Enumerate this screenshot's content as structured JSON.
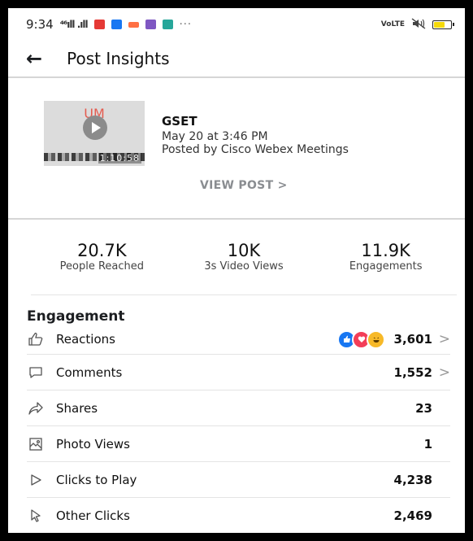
{
  "status_bar": {
    "time": "9:34",
    "signal_text": "⁴⁶ıll .ıll",
    "more": "···",
    "volte": "VoLTE"
  },
  "header": {
    "title": "Post Insights"
  },
  "post": {
    "thumbnail_text": "UM",
    "thumbnail_time": "1:10:58",
    "title": "GSET",
    "date": "May 20 at 3:46 PM",
    "posted_by": "Posted by Cisco Webex Meetings",
    "view_post_label": "VIEW POST >"
  },
  "metrics": [
    {
      "value": "20.7K",
      "label": "People Reached"
    },
    {
      "value": "10K",
      "label": "3s Video Views"
    },
    {
      "value": "11.9K",
      "label": "Engagements"
    }
  ],
  "engagement": {
    "title": "Engagement",
    "rows": [
      {
        "label": "Reactions",
        "value": "3,601",
        "icon": "thumbs-up-icon",
        "chevron": ">"
      },
      {
        "label": "Comments",
        "value": "1,552",
        "icon": "comment-icon",
        "chevron": ">"
      },
      {
        "label": "Shares",
        "value": "23",
        "icon": "share-icon",
        "chevron": ""
      },
      {
        "label": "Photo Views",
        "value": "1",
        "icon": "photo-icon",
        "chevron": ""
      },
      {
        "label": "Clicks to Play",
        "value": "4,238",
        "icon": "play-icon",
        "chevron": ""
      },
      {
        "label": "Other Clicks",
        "value": "2,469",
        "icon": "cursor-icon",
        "chevron": ""
      }
    ]
  },
  "colors": {
    "like_blue": "#1877f2",
    "love_red": "#f33e58",
    "haha_yellow": "#f7b928",
    "battery_yellow": "#f5d90a"
  }
}
